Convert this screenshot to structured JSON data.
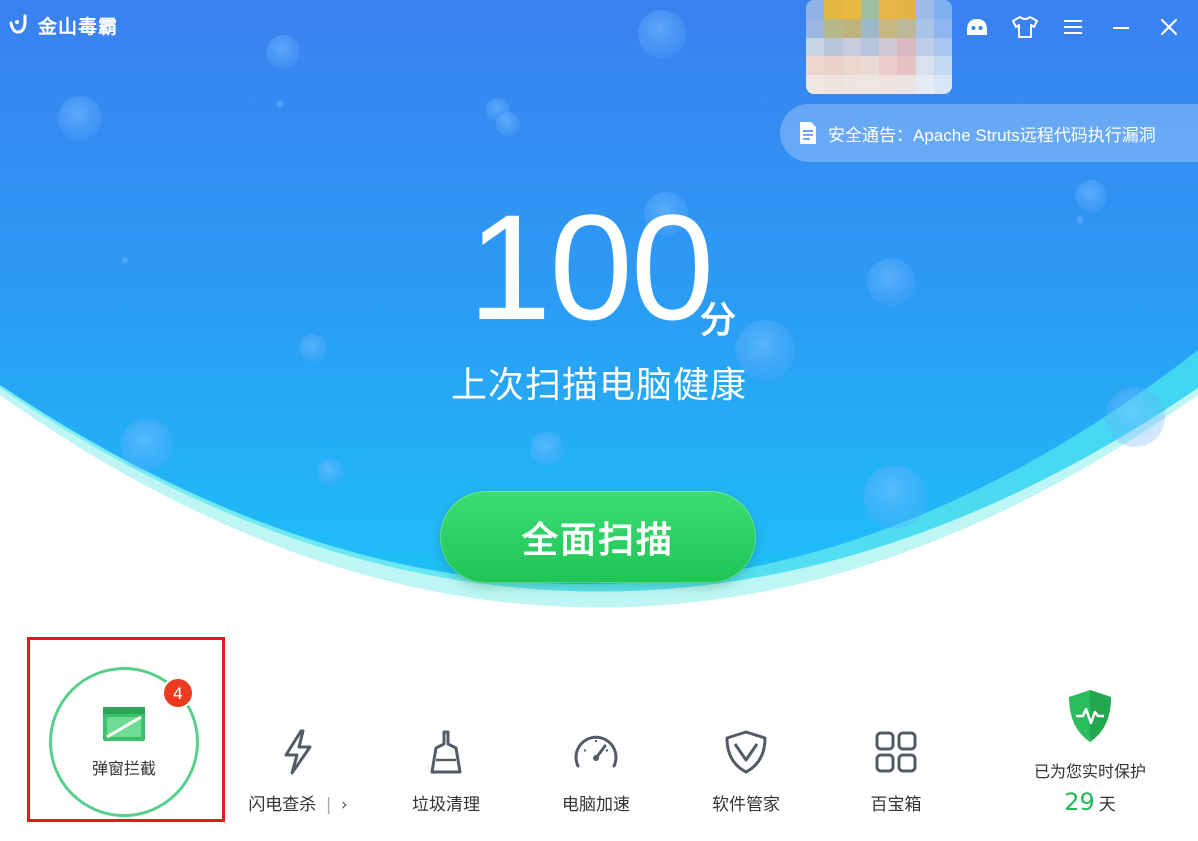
{
  "app": {
    "name": "金山毒霸"
  },
  "window_controls": [
    "robot-icon",
    "shirt-icon",
    "menu-icon",
    "minimize-icon",
    "close-icon"
  ],
  "notice": {
    "text": "安全通告：Apache Struts远程代码执行漏洞"
  },
  "score": {
    "value": "100",
    "unit": "分",
    "description": "上次扫描电脑健康"
  },
  "scan_button": {
    "label": "全面扫描"
  },
  "popup_block": {
    "label": "弹窗拦截",
    "badge": "4"
  },
  "tools": [
    {
      "label": "闪电查杀",
      "icon": "lightning-icon"
    },
    {
      "label": "垃圾清理",
      "icon": "broom-icon"
    },
    {
      "label": "电脑加速",
      "icon": "speedometer-icon"
    },
    {
      "label": "软件管家",
      "icon": "shield-app-icon"
    },
    {
      "label": "百宝箱",
      "icon": "grid-icon"
    }
  ],
  "protection": {
    "label": "已为您实时保护",
    "days": "29",
    "days_unit": "天"
  },
  "colors": {
    "hero_top": "#3a86f0",
    "hero_bottom": "#22b9f7",
    "scan_green": "#2ad266",
    "highlight_red": "#e8191b",
    "badge_red": "#ec3a1f"
  }
}
